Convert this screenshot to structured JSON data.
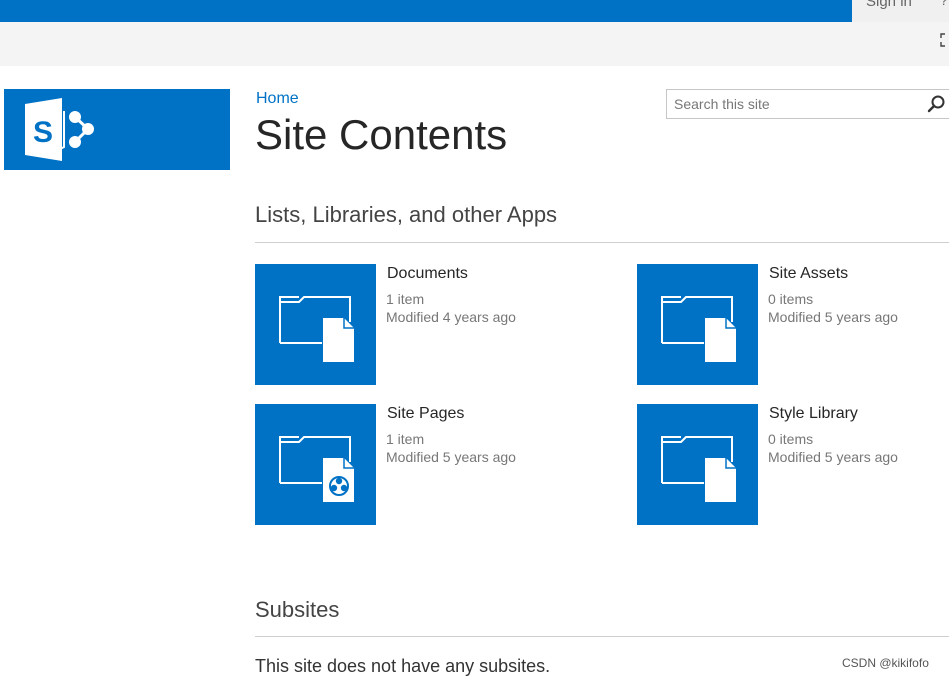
{
  "header": {
    "sign_in_label": "Sign in"
  },
  "breadcrumb": {
    "home_label": "Home"
  },
  "page": {
    "title": "Site Contents"
  },
  "search": {
    "placeholder": "Search this site"
  },
  "sections": {
    "apps_heading": "Lists, Libraries, and other Apps",
    "subsites_heading": "Subsites",
    "subsites_empty_text": "This site does not have any subsites."
  },
  "apps": [
    {
      "name": "Documents",
      "count": "1 item",
      "modified": "Modified 4 years ago",
      "icon": "document-library-icon"
    },
    {
      "name": "Site Assets",
      "count": "0 items",
      "modified": "Modified 5 years ago",
      "icon": "document-library-icon"
    },
    {
      "name": "Site Pages",
      "count": "1 item",
      "modified": "Modified 5 years ago",
      "icon": "site-pages-library-icon"
    },
    {
      "name": "Style Library",
      "count": "0 items",
      "modified": "Modified 5 years ago",
      "icon": "document-library-icon"
    }
  ],
  "watermark": "CSDN @kikifofo",
  "colors": {
    "brand_blue": "#0072c6",
    "ribbon_gray": "#f4f4f4"
  }
}
